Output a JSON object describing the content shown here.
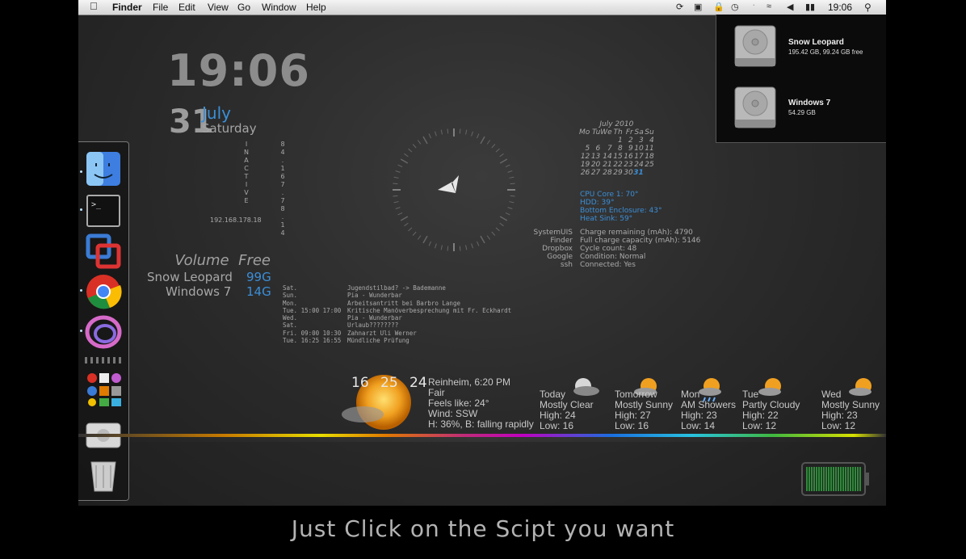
{
  "menubar": {
    "app_name": "Finder",
    "menus": [
      "File",
      "Edit",
      "View",
      "Go",
      "Window",
      "Help"
    ],
    "clock": "19:06"
  },
  "clock": {
    "time": "19:06",
    "day_number": "31",
    "month": "July",
    "weekday": "Saturday"
  },
  "vertical_text": {
    "letters": [
      "I",
      "N",
      "A",
      "C",
      "T",
      "I",
      "V",
      "E"
    ],
    "digits": [
      "8",
      "4",
      ".",
      "1",
      "6",
      "7",
      ".",
      "7",
      "8",
      ".",
      "1",
      "4"
    ]
  },
  "ip_address": "192.168.178.18",
  "volumes": {
    "header_label": "Volume",
    "header_free": "Free",
    "rows": [
      {
        "name": "Snow Leopard",
        "free": "99G"
      },
      {
        "name": "Windows 7",
        "free": "14G"
      }
    ]
  },
  "calendar": {
    "title": "July 2010",
    "weekdays": [
      "Mo",
      "Tu",
      "We",
      "Th",
      "Fr",
      "Sa",
      "Su"
    ],
    "weeks": [
      [
        "",
        "",
        "",
        "1",
        "2",
        "3",
        "4"
      ],
      [
        "5",
        "6",
        "7",
        "8",
        "9",
        "10",
        "11"
      ],
      [
        "12",
        "13",
        "14",
        "15",
        "16",
        "17",
        "18"
      ],
      [
        "19",
        "20",
        "21",
        "22",
        "23",
        "24",
        "25"
      ],
      [
        "26",
        "27",
        "28",
        "29",
        "30",
        "31",
        ""
      ]
    ],
    "today": "31"
  },
  "temps": [
    "CPU Core 1: 70°",
    "HDD: 39°",
    "Bottom Enclosure: 43°",
    "Heat Sink: 59°"
  ],
  "battery_apps": [
    "SystemUIS",
    "Finder",
    "Dropbox",
    "Google",
    "ssh"
  ],
  "battery_info": [
    "Charge remaining (mAh): 4790",
    "Full charge capacity (mAh): 5146",
    "Cycle count: 48",
    "Condition: Normal",
    "Connected: Yes"
  ],
  "schedule": [
    {
      "day": "Sat.",
      "text": "Jugendstilbad? -> Bademanne"
    },
    {
      "day": "Sun.",
      "text": "Pia - Wunderbar"
    },
    {
      "day": "Mon.",
      "text": "Arbeitsantritt bei Barbro Lange"
    },
    {
      "day": "Tue. 15:00 17:00",
      "text": "Kritische Manöverbesprechung mit Fr. Eckhardt"
    },
    {
      "day": "Wed.",
      "text": "Pia - Wunderbar"
    },
    {
      "day": "Sat.",
      "text": "Urlaub????????"
    },
    {
      "day": "Fri. 09:00 10:30",
      "text": "Zahnarzt Uli Werner"
    },
    {
      "day": "Tue. 16:25 16:55",
      "text": "Mündliche Prüfung"
    }
  ],
  "drives": [
    {
      "name": "Snow Leopard",
      "info": "195.42 GB, 99.24 GB free"
    },
    {
      "name": "Windows 7",
      "info": "54.29 GB"
    }
  ],
  "weather_now": {
    "low": "16",
    "current": "25",
    "high": "24",
    "location": "Reinheim, 6:20 PM",
    "condition": "Fair",
    "feels": "Feels like: 24°",
    "wind": "Wind: SSW",
    "humidity": "H: 36%, B: falling rapidly"
  },
  "forecast": [
    {
      "day": "Today",
      "cond": "Mostly Clear",
      "high": "High: 24",
      "low": "Low: 16",
      "icon": "moon-cloud-icon"
    },
    {
      "day": "Tomorrow",
      "cond": "Mostly Sunny",
      "high": "High: 27",
      "low": "Low: 16",
      "icon": "sun-cloud-icon"
    },
    {
      "day": "Mon",
      "cond": "AM Showers",
      "high": "High: 23",
      "low": "Low: 14",
      "icon": "sun-rain-icon"
    },
    {
      "day": "Tue",
      "cond": "Partly Cloudy",
      "high": "High: 22",
      "low": "Low: 12",
      "icon": "sun-cloud-icon"
    },
    {
      "day": "Wed",
      "cond": "Mostly Sunny",
      "high": "High: 23",
      "low": "Low: 12",
      "icon": "sun-cloud-icon"
    }
  ],
  "caption": "Just Click on the Scipt you want"
}
